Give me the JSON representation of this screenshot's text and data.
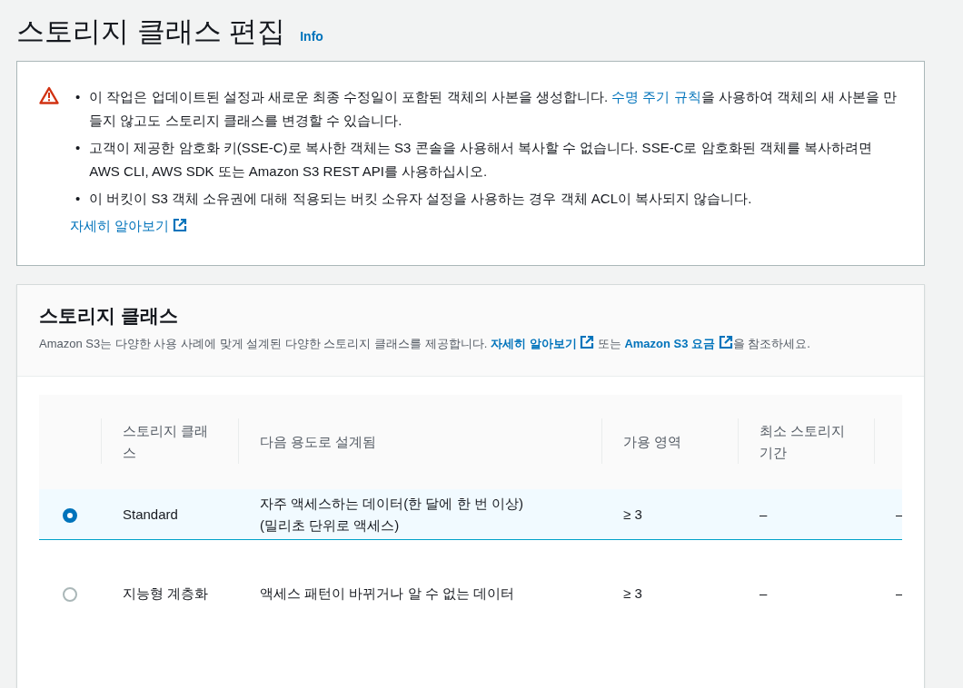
{
  "page": {
    "title": "스토리지 클래스 편집",
    "info_link": "Info"
  },
  "alert": {
    "kind": "warning",
    "items": [
      {
        "bullet": "•",
        "segments": [
          {
            "text": "이 작업은 업데이트된 설정과 새로운 최종 수정일이 포함된 객체의 사본을 생성합니다. ",
            "link": false
          },
          {
            "text": "수명 주기 규칙",
            "link": true
          },
          {
            "text": "을 사용하여 객체의 새 사본을 만들지 않고도 스토리지 클래스를 변경할 수 있습니다.",
            "link": false
          }
        ]
      },
      {
        "bullet": "•",
        "segments": [
          {
            "text": "고객이 제공한 암호화 키(SSE-C)로 복사한 객체는 S3 콘솔을 사용해서 복사할 수 없습니다. SSE-C로 암호화된 객체를 복사하려면 AWS CLI, AWS SDK 또는 Amazon S3 REST API를 사용하십시오.",
            "link": false
          }
        ]
      },
      {
        "bullet": "•",
        "segments": [
          {
            "text": "이 버킷이 S3 객체 소유권에 대해 적용되는 버킷 소유자 설정을 사용하는 경우 객체 ACL이 복사되지 않습니다.",
            "link": false
          }
        ]
      }
    ],
    "learn_more": "자세히 알아보기"
  },
  "storage_class": {
    "title": "스토리지 클래스",
    "description": [
      {
        "text": "Amazon S3는 다양한 사용 사례에 맞게 설계된 다양한 스토리지 클래스를 제공합니다. ",
        "link": false
      },
      {
        "text": "자세히 알아보기",
        "link": true
      },
      {
        "text": " 또는 ",
        "link": false
      },
      {
        "text": "Amazon S3 요금",
        "link": true
      },
      {
        "text": "을 참조하세요.",
        "link": false
      }
    ],
    "table": {
      "columns": [
        "스토리지 클래스",
        "다음 용도로 설계됨",
        "가용 영역",
        "최소 스토리지 기간"
      ],
      "rows": [
        {
          "selected": true,
          "storage_class": "Standard",
          "designed_for": [
            "자주 액세스하는 데이터(한 달에 한 번 이상)",
            "(밀리초 단위로 액세스)"
          ],
          "availability_zones": "≥ 3",
          "minimum_duration": "–",
          "column_6": "–"
        },
        {
          "selected": false,
          "storage_class": "지능형 계층화",
          "designed_for": [
            "액세스 패턴이 바뀌거나 알 수 없는 데이터"
          ],
          "availability_zones": "≥ 3",
          "minimum_duration": "–",
          "column_6": "–"
        }
      ]
    }
  }
}
